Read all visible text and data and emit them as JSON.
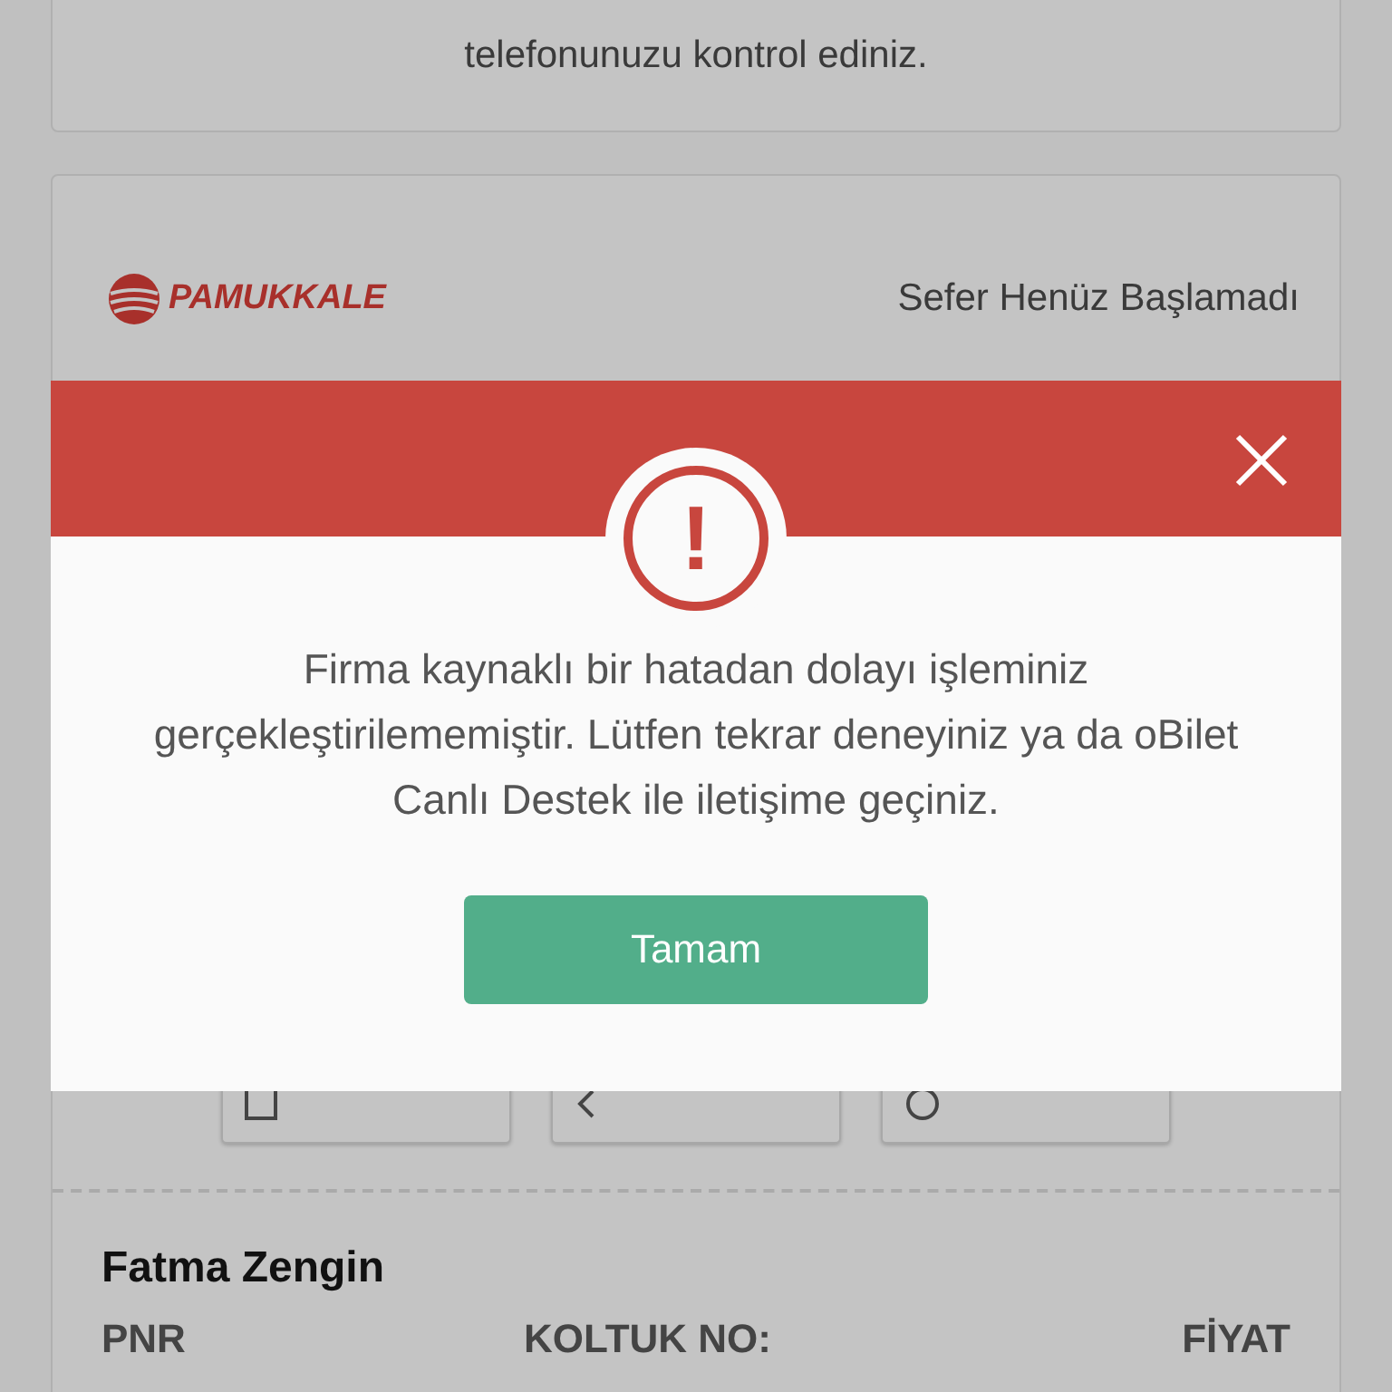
{
  "info_notice": {
    "text": "telefonunuzu kontrol ediniz."
  },
  "ticket": {
    "brand": "PAMUKKALE",
    "status": "Sefer Henüz Başlamadı",
    "actions": [
      {
        "kind": "ticket"
      },
      {
        "kind": "change"
      },
      {
        "kind": "cancel"
      }
    ],
    "passenger": {
      "name": "Fatma Zengin",
      "labels": [
        "PNR",
        "KOLTUK NO:",
        "FİYAT"
      ]
    }
  },
  "dialog": {
    "icon": "!",
    "message": "Firma kaynaklı bir hatadan dolayı işleminiz gerçekleştirilememiştir. Lütfen tekrar deneyiniz ya da oBilet Canlı Destek ile iletişime geçiniz.",
    "button": "Tamam"
  }
}
